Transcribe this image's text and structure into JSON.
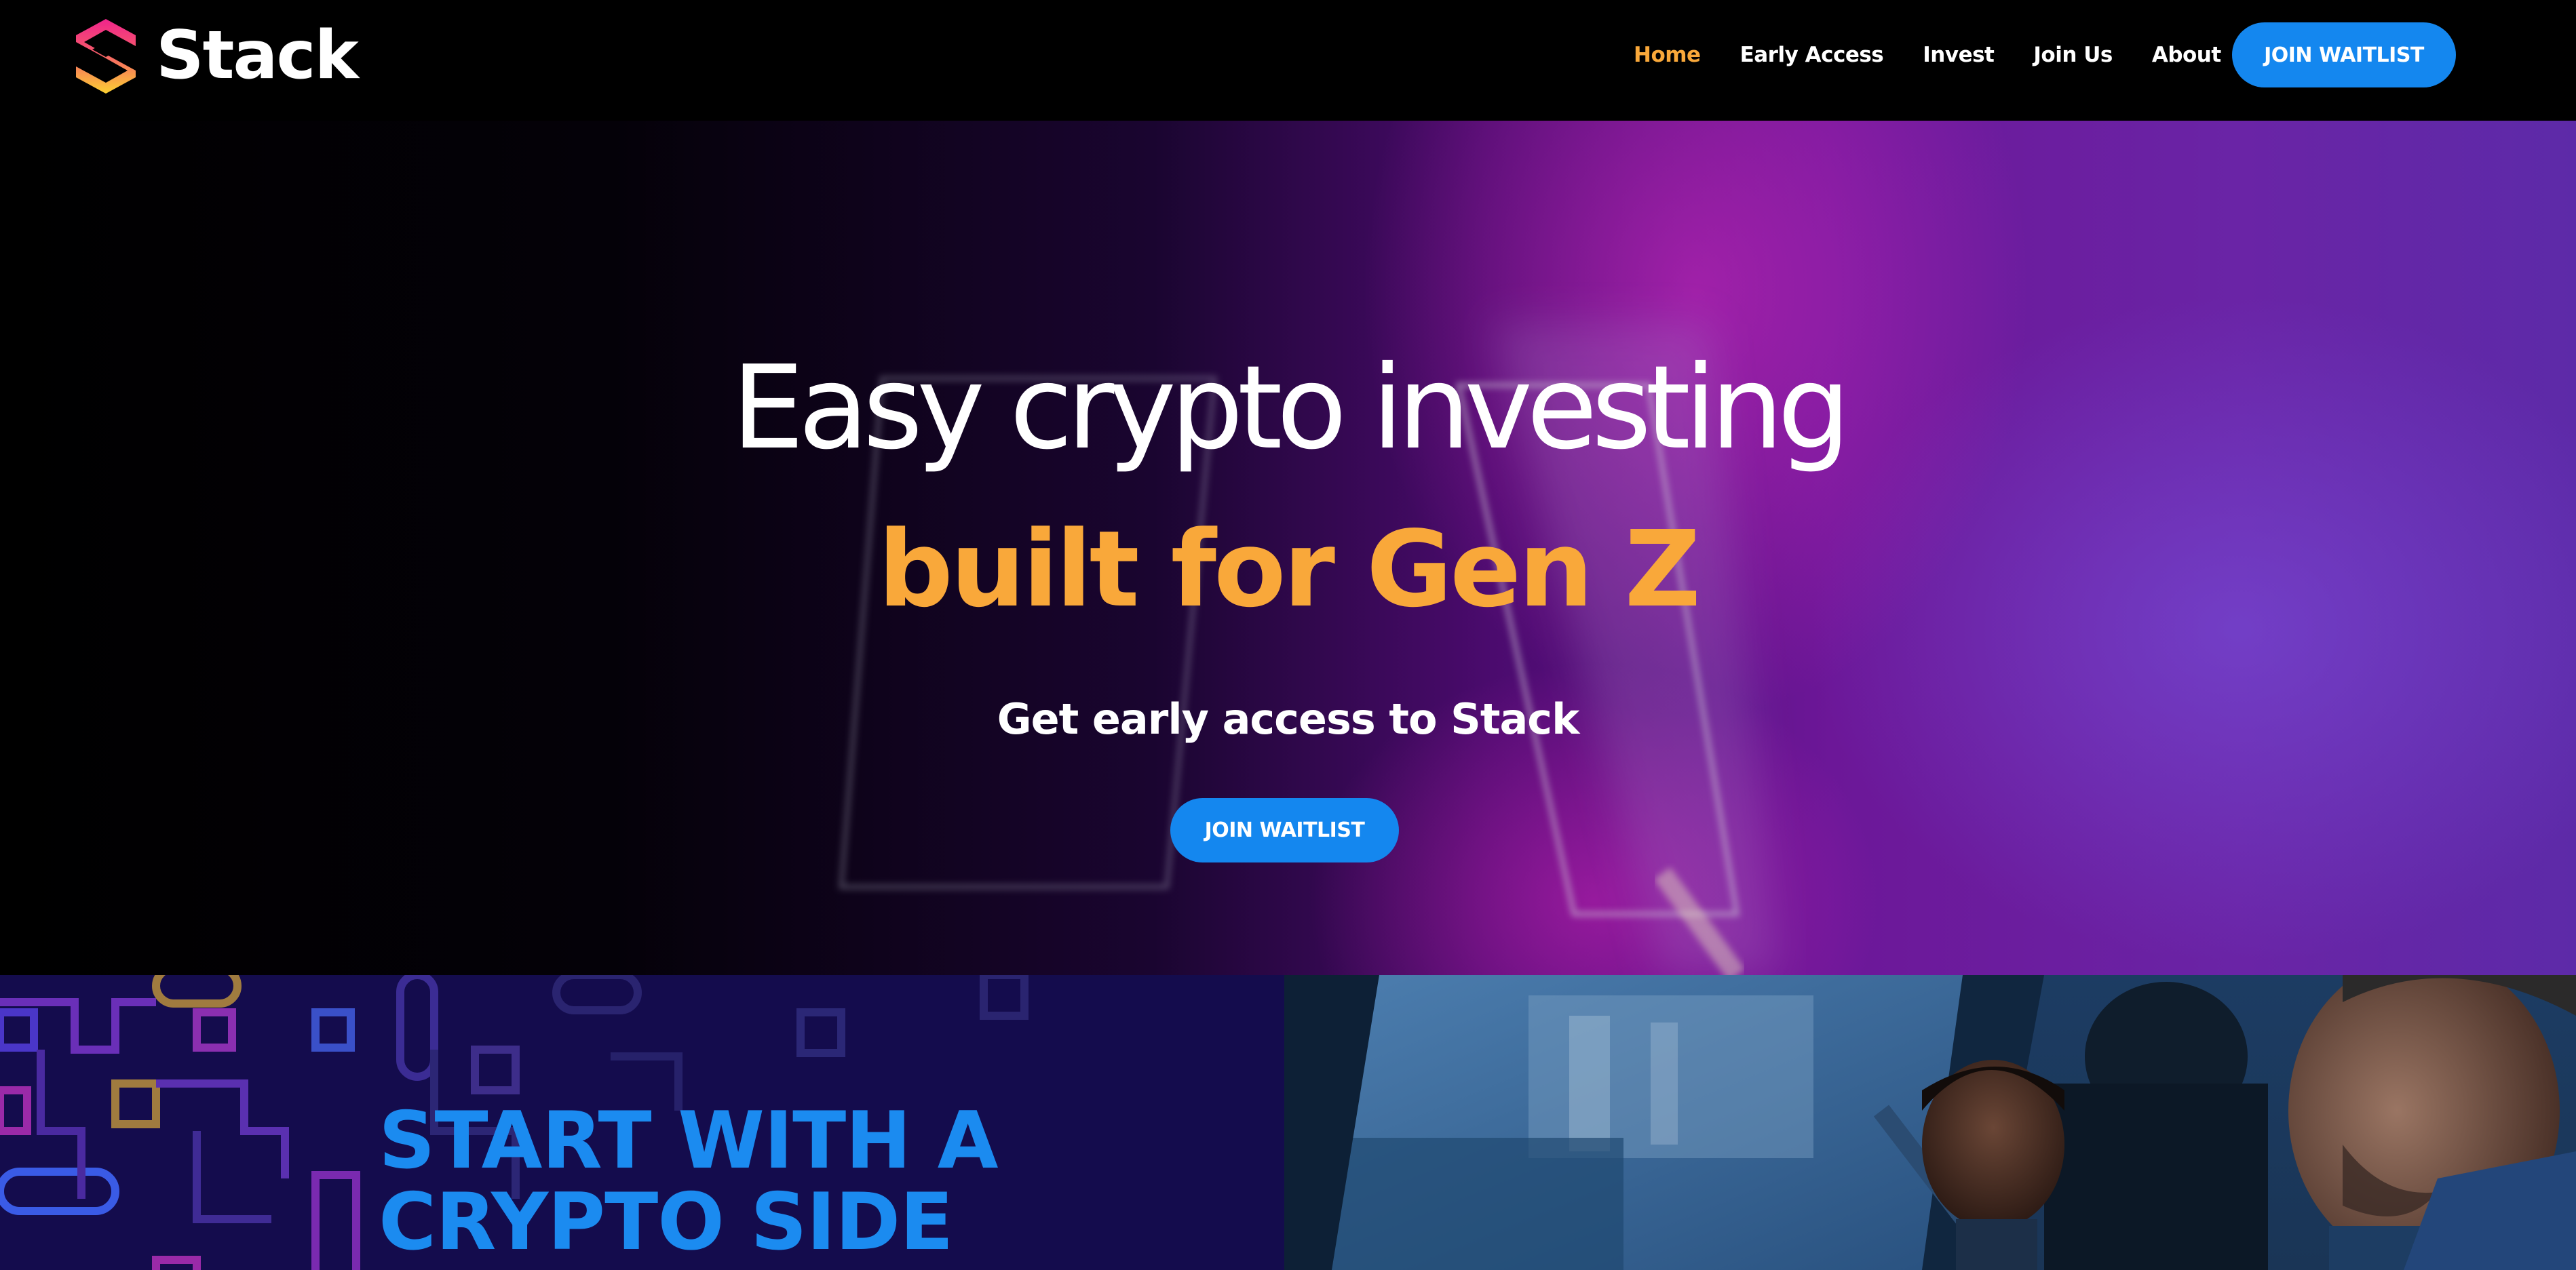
{
  "brand": {
    "name": "Stack"
  },
  "nav": {
    "links": [
      {
        "label": "Home",
        "active": true
      },
      {
        "label": "Early Access",
        "active": false
      },
      {
        "label": "Invest",
        "active": false
      },
      {
        "label": "Join Us",
        "active": false
      },
      {
        "label": "About",
        "active": false
      }
    ],
    "cta_label": "JOIN WAITLIST"
  },
  "hero": {
    "title_line1": "Easy crypto investing",
    "title_line2": "built for Gen Z",
    "subtitle": "Get early access to Stack",
    "cta_label": "JOIN WAITLIST"
  },
  "side_section": {
    "heading_line1": "START WITH A",
    "heading_line2": "CRYPTO SIDE"
  },
  "colors": {
    "accent_orange": "#f9a83a",
    "button_blue": "#1487ef",
    "heading_blue": "#1b8bf0",
    "navbar_bg": "#000000"
  },
  "icons": {
    "logo": "stack-logo-icon"
  }
}
